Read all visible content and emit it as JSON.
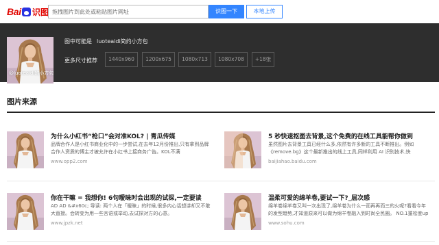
{
  "header": {
    "logo_bai": "Bai",
    "logo_shitu": "识图",
    "search_placeholder": "拖拽图片到此处或粘贴图片网址",
    "search_button": "识图一下",
    "upload_button": "本地上传"
  },
  "hero": {
    "watermark": "@luoteaidi的小方包",
    "guess_label": "图中可能是",
    "guess_value": "luoteaidi简约小方包",
    "sizes_label": "更多尺寸推荐",
    "sizes": [
      "1440x960",
      "1200x675",
      "1080x713",
      "1080x708",
      "+18张"
    ]
  },
  "sources": {
    "title": "图片来源",
    "items": [
      {
        "title": "为什么小红书“枪口”会对准KOL? | 青瓜传媒",
        "desc": "品牌合作人是小红书商业化中的一步尝试,在去年12月份推出,只有拿到品牌合作人资质的博主才被允许在小红书上接商务广告。KOL不满",
        "source": "www.opp2.com"
      },
      {
        "title": "5 秒快速抠图去背景,这个免费的在线工具能帮你做到",
        "desc": "虽然图片去背景工具已经什么多,依然有许多新的工具不断推出。例如《remove.bg》这个最新推出的线上工具,同样利用 AI 识别技术,快",
        "source": "baijiahao.baidu.com"
      },
      {
        "title": "你在干嘛 = 我想你! 6句暧昧时会出现的试探,一定要读",
        "desc": "AD AD &#x60c; 导读: 两个人在「暧昧」的时候,很多内心话想讲却又不敢大直接。会转变为用一些言语或举动,去试探对方的心意。",
        "source": "www.jpzk.net"
      },
      {
        "title": "温柔可爱的绵羊卷,要试一下?_层次感",
        "desc": "绵羊卷绵羊卷又叫一次出现了,绵羊卷为什么一而再再而三的火呢?看看今年的发型趋势,才知道原来可以做为绵羊卷融入到时尚全民圈。 NO.1蓬松度up 卷发",
        "source": "www.sohu.com"
      }
    ]
  }
}
